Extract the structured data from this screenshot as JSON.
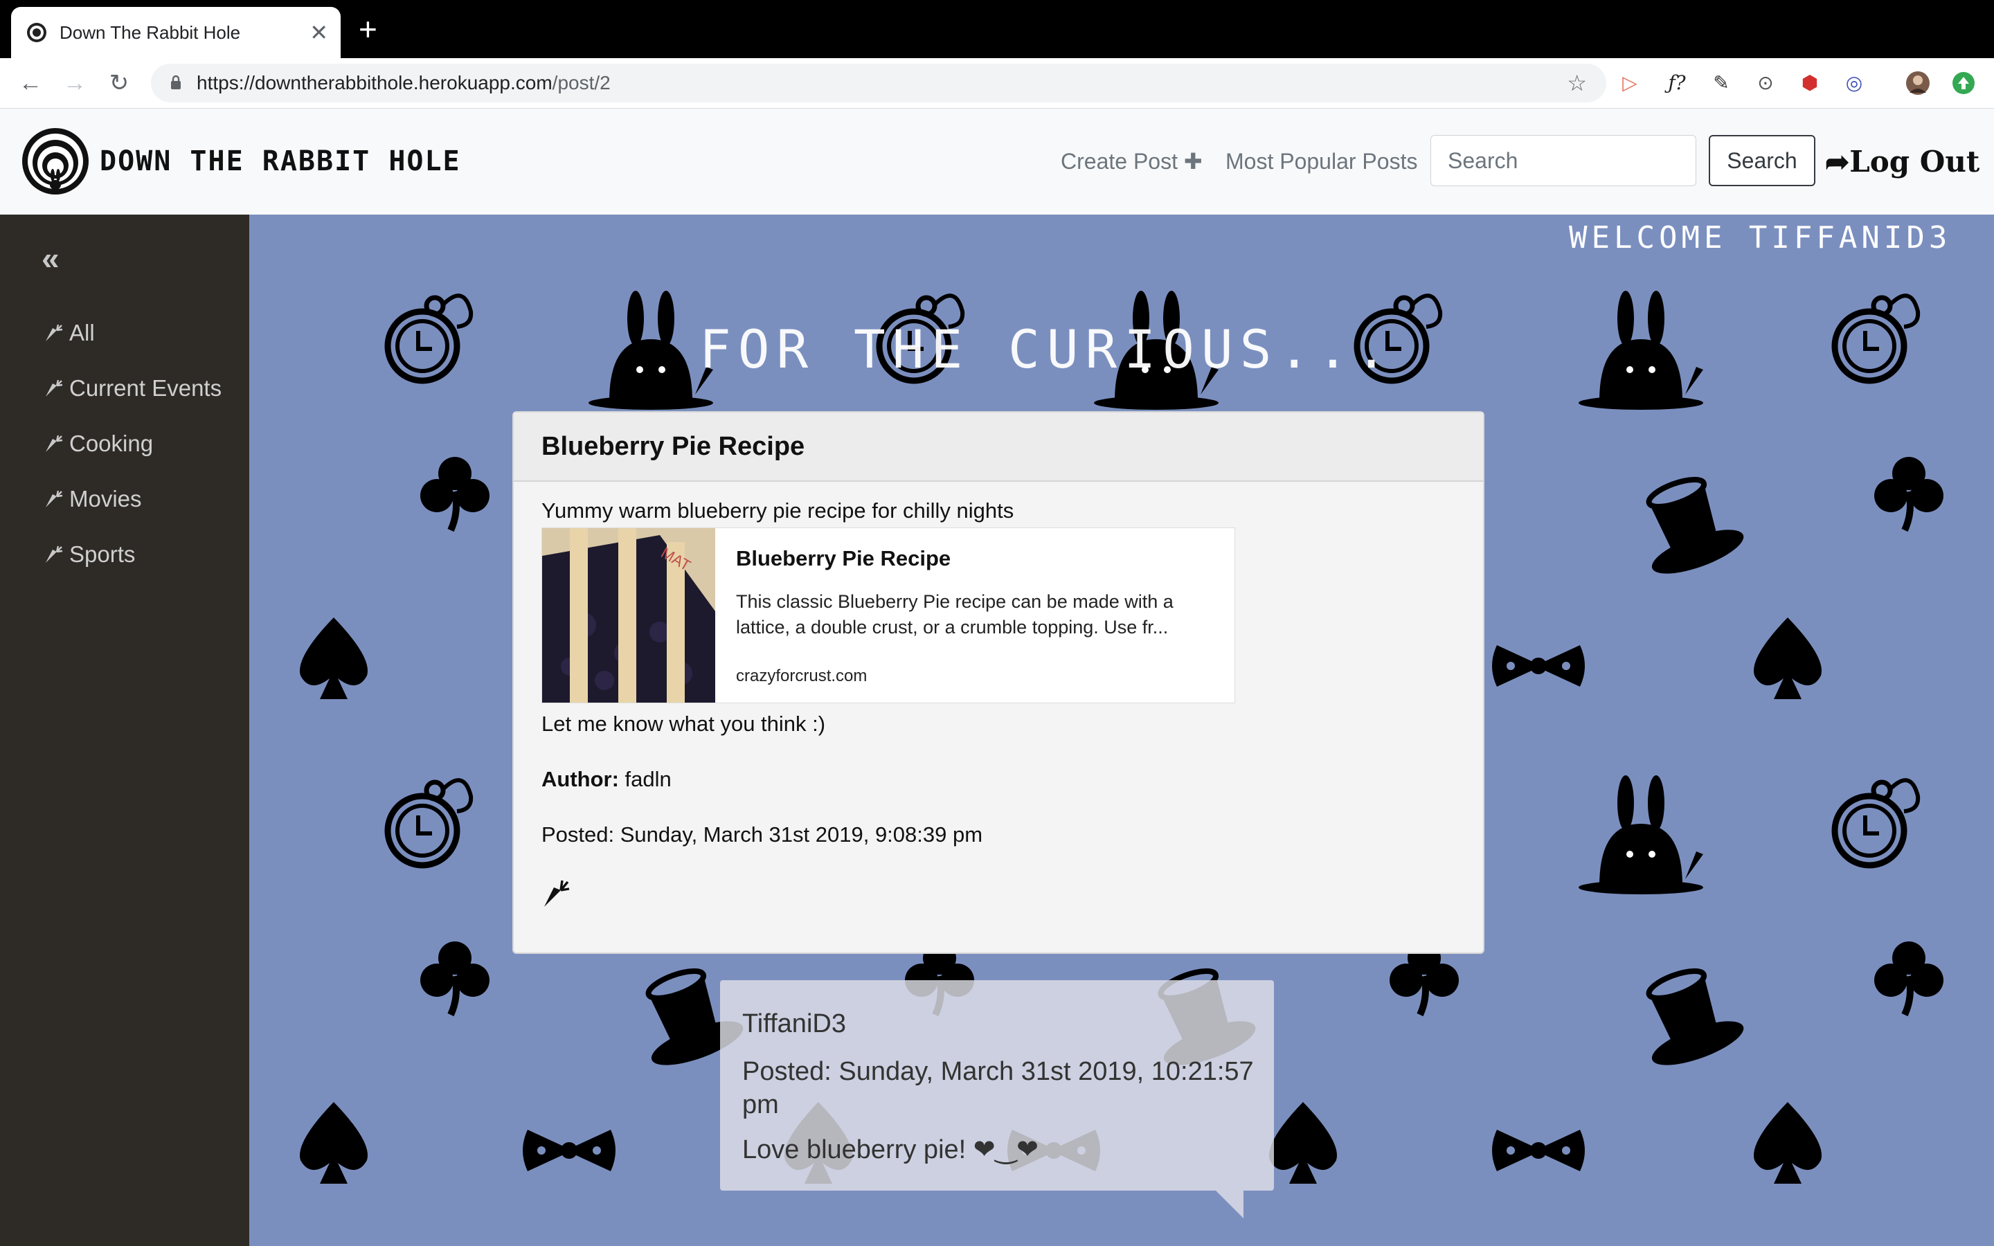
{
  "browser": {
    "tab_title": "Down The Rabbit Hole",
    "tab_close": "✕",
    "new_tab": "+",
    "url_host": "https://downtherabbithole.herokuapp.com",
    "url_path": "/post/2",
    "back": "←",
    "forward": "→",
    "reload": "↻",
    "star": "☆",
    "extensions": [
      "fx-icon",
      "font-icon",
      "eyedropper-icon",
      "code-icon",
      "shield-icon",
      "glasses-icon",
      "avatar",
      "update-icon"
    ],
    "ext_glyphs": [
      "▷",
      "ƒ?",
      "✎",
      "⊙",
      "⬢",
      "◎",
      "",
      "⬆"
    ]
  },
  "navbar": {
    "brand": "DOWN THE RABBIT HOLE",
    "create_post": "Create Post ✚",
    "popular": "Most Popular Posts",
    "search_placeholder": "Search",
    "search_button": "Search",
    "logout": "Log Out",
    "logout_icon": "➦"
  },
  "sidebar": {
    "collapse": "«",
    "items": [
      {
        "label": "All"
      },
      {
        "label": "Current Events"
      },
      {
        "label": "Cooking"
      },
      {
        "label": "Movies"
      },
      {
        "label": "Sports"
      }
    ]
  },
  "main": {
    "welcome": "WELCOME TIFFANID3",
    "tagline": "FOR THE CURIOUS..."
  },
  "post": {
    "title": "Blueberry Pie Recipe",
    "description": "Yummy warm blueberry pie recipe for chilly nights",
    "preview": {
      "title": "Blueberry Pie Recipe",
      "description": "This classic Blueberry Pie recipe can be made with a lattice, a double crust, or a crumble topping. Use fr...",
      "site": "crazyforcrust.com"
    },
    "after_text": "Let me know what you think :)",
    "author_label": "Author:",
    "author": "fadln",
    "posted": "Posted: Sunday, March 31st 2019, 9:08:39 pm"
  },
  "comment": {
    "author": "TiffaniD3",
    "posted": "Posted: Sunday, March 31st 2019, 10:21:57 pm",
    "text": "Love blueberry pie! ❤︎‿❤︎"
  },
  "colors": {
    "page_bg": "#7b8fbf",
    "sidebar_bg": "#2e2b27",
    "navbar_bg": "#f8f9fa",
    "card_bg": "#f4f4f4"
  }
}
